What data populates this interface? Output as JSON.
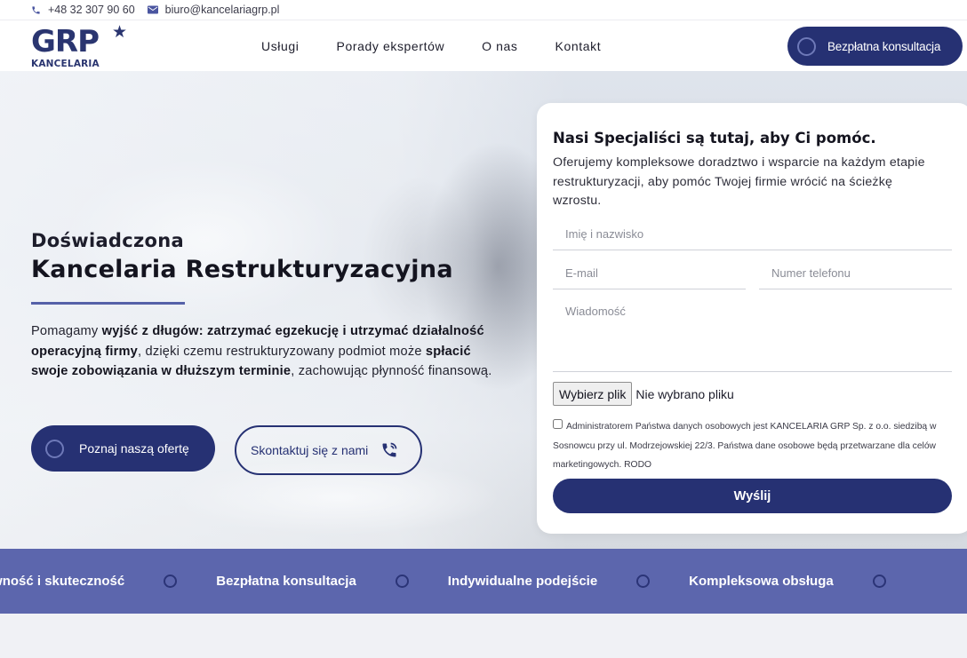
{
  "topbar": {
    "phone": "+48 32 307 90 60",
    "email": "biuro@kancelariagrp.pl"
  },
  "header": {
    "logo_main": "GRP",
    "logo_sub": "KANCELARIA",
    "nav": [
      "Usługi",
      "Porady ekspertów",
      "O nas",
      "Kontakt"
    ],
    "cta": "Bezpłatna konsultacja"
  },
  "hero": {
    "pre_title": "Doświadczona",
    "title": "Kancelaria Restrukturyzacyjna",
    "desc": {
      "p1": "Pomagamy ",
      "b1": "wyjść z długów: zatrzymać egzekucję i utrzymać działalność operacyjną firmy",
      "p2": ", dzięki czemu restrukturyzowany podmiot może ",
      "b2": "spłacić swoje zobowiązania w dłuższym terminie",
      "p3": ", zachowując płynność finansową."
    },
    "btn_offer": "Poznaj naszą ofertę",
    "btn_contact": "Skontaktuj się z nami"
  },
  "form": {
    "title": "Nasi Specjaliści są tutaj, aby Ci pomóc.",
    "desc": "Oferujemy kompleksowe doradztwo i wsparcie na każdym etapie restrukturyzacji, aby pomóc Twojej firmie wrócić na ścieżkę wzrostu.",
    "name_placeholder": "Imię i nazwisko",
    "email_placeholder": "E-mail",
    "phone_placeholder": "Numer telefonu",
    "message_placeholder": "Wiadomość",
    "file_button": "Wybierz plik",
    "file_status": "Nie wybrano pliku",
    "consent": "Administratorem Państwa danych osobowych jest KANCELARIA GRP Sp. z o.o. siedzibą w Sosnowcu przy ul. Modrzejowskiej 22/3. Państwa dane osobowe będą przetwarzane dla celów marketingowych. RODO",
    "submit": "Wyślij"
  },
  "ticker": [
    "Efektywność i skuteczność",
    "Bezpłatna konsultacja",
    "Indywidualne podejście",
    "Kompleksowa obsługa"
  ],
  "colors": {
    "brand": "#263173",
    "strip": "#5c66ad",
    "accent_line": "#5561a8"
  }
}
